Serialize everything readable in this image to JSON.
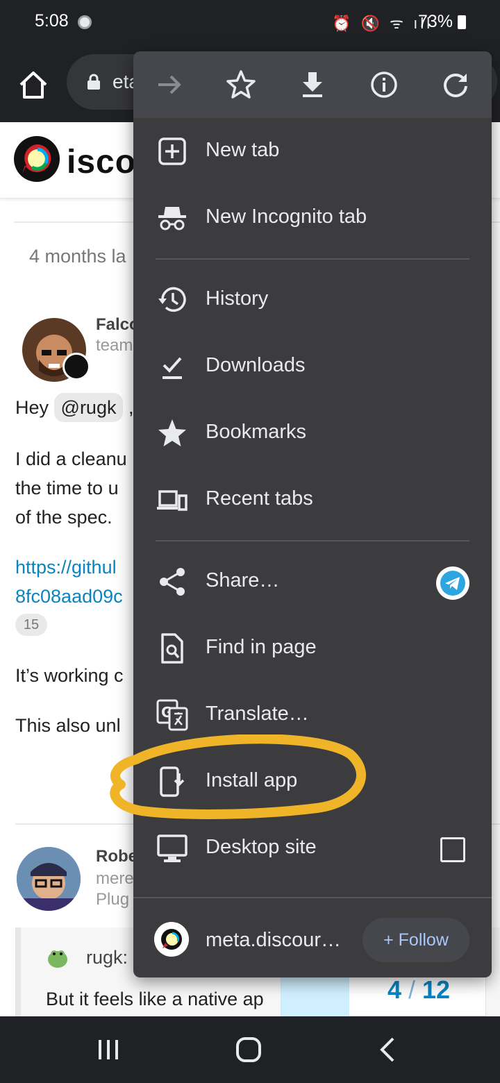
{
  "status_bar": {
    "time": "5:08",
    "battery": "73%"
  },
  "toolbar": {
    "url_fragment": "eta"
  },
  "page": {
    "logo_text": "isco",
    "gap_text": "4 months la",
    "post1": {
      "username": "Falco",
      "user_title": "team",
      "greeting_prefix": "Hey ",
      "mention": "@rugk",
      "greeting_suffix": " ,",
      "para_lines": [
        "I did a cleanu",
        "the time to u",
        "of the spec."
      ],
      "link_lines": [
        "https://githul",
        "8fc08aad09c"
      ],
      "link_count": "15",
      "line_working": "It’s working c",
      "line_also": "This also unl"
    },
    "post2": {
      "username": "Robe",
      "line2": "mere",
      "line3": "Plug"
    },
    "quote": {
      "user": "rugk:",
      "text": "But it feels like a native ap"
    },
    "progress": {
      "current": "4",
      "separator": "/",
      "total": "12",
      "fraction": 0.333
    }
  },
  "menu": {
    "top_icons": [
      "forward-icon",
      "star-icon",
      "download-icon",
      "info-icon",
      "reload-icon"
    ],
    "items": [
      {
        "label": "New tab",
        "icon": "new-tab-icon"
      },
      {
        "label": "New Incognito tab",
        "icon": "incognito-icon"
      },
      {
        "label": "History",
        "icon": "history-icon"
      },
      {
        "label": "Downloads",
        "icon": "downloads-icon"
      },
      {
        "label": "Bookmarks",
        "icon": "bookmarks-icon"
      },
      {
        "label": "Recent tabs",
        "icon": "recent-tabs-icon"
      },
      {
        "label": "Share…",
        "icon": "share-icon"
      },
      {
        "label": "Find in page",
        "icon": "find-in-page-icon"
      },
      {
        "label": "Translate…",
        "icon": "translate-icon"
      },
      {
        "label": "Install app",
        "icon": "install-app-icon"
      },
      {
        "label": "Desktop site",
        "icon": "desktop-site-icon"
      }
    ],
    "footer": {
      "site": "meta.discour…",
      "follow_label": "+ Follow"
    }
  },
  "colors": {
    "menu_bg": "#3c3c3f",
    "link": "#0a84c1",
    "highlight": "#f0b429"
  }
}
